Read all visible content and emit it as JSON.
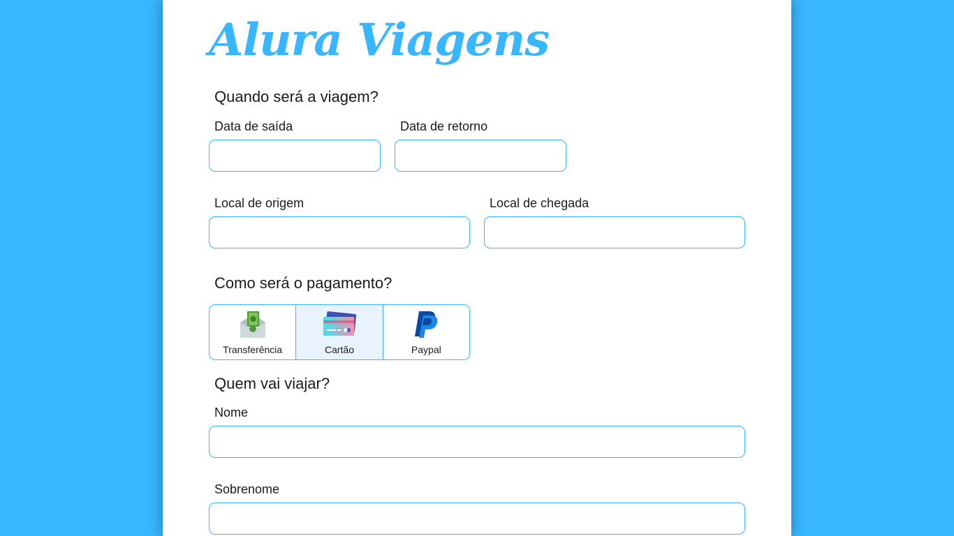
{
  "brand": {
    "logo_text": "Alura Viagens",
    "accent_color": "#38b6ff"
  },
  "trip": {
    "title": "Quando será a viagem?",
    "departure_label": "Data de saída",
    "departure_value": "",
    "return_label": "Data de retorno",
    "return_value": "",
    "origin_label": "Local de origem",
    "origin_value": "",
    "destination_label": "Local de chegada",
    "destination_value": ""
  },
  "payment": {
    "title": "Como será o pagamento?",
    "options": [
      {
        "label": "Transferência",
        "icon": "bank-transfer-envelope-icon",
        "selected": false
      },
      {
        "label": "Cartão",
        "icon": "credit-card-icon",
        "selected": true
      },
      {
        "label": "Paypal",
        "icon": "paypal-logo-icon",
        "selected": false
      }
    ]
  },
  "traveler": {
    "title": "Quem vai viajar?",
    "first_name_label": "Nome",
    "first_name_value": "",
    "last_name_label": "Sobrenome",
    "last_name_value": ""
  }
}
